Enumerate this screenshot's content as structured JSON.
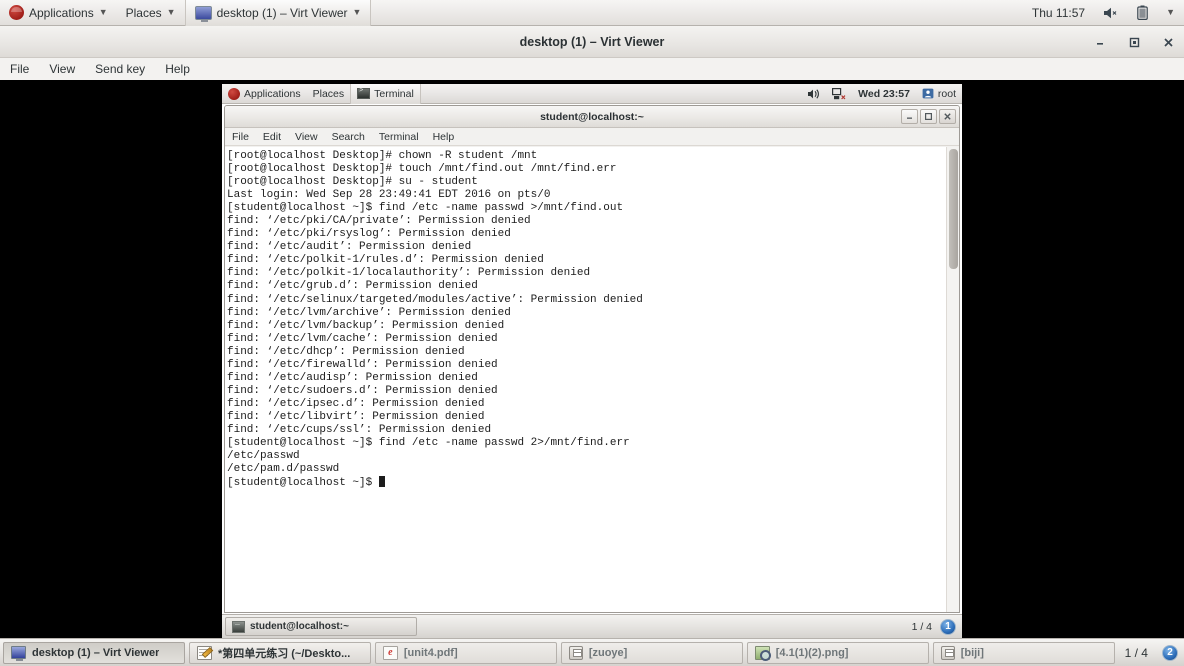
{
  "host_panel": {
    "applications_label": "Applications",
    "places_label": "Places",
    "active_window_label": "desktop (1) – Virt Viewer",
    "clock": "Thu 11:57",
    "icons": [
      "fedora-logo",
      "volume-muted-icon",
      "battery-icon",
      "chevron-down-icon"
    ]
  },
  "virt_viewer": {
    "title": "desktop (1) – Virt Viewer",
    "menu": [
      "File",
      "View",
      "Send key",
      "Help"
    ],
    "window_buttons": {
      "minimize": "–",
      "maximize": "❐",
      "close": "✕"
    }
  },
  "vm": {
    "top_panel": {
      "applications_label": "Applications",
      "places_label": "Places",
      "active_window_label": "Terminal",
      "clock": "Wed 23:57",
      "user": "root",
      "icons": [
        "volume-icon",
        "network-disconnected-icon",
        "user-icon"
      ]
    },
    "terminal": {
      "title": "student@localhost:~",
      "menu": [
        "File",
        "Edit",
        "View",
        "Search",
        "Terminal",
        "Help"
      ],
      "window_buttons": {
        "minimize": "–",
        "maximize": "❐",
        "close": "✕"
      },
      "lines": [
        "[root@localhost Desktop]# chown -R student /mnt",
        "[root@localhost Desktop]# touch /mnt/find.out /mnt/find.err",
        "[root@localhost Desktop]# su - student",
        "Last login: Wed Sep 28 23:49:41 EDT 2016 on pts/0",
        "[student@localhost ~]$ find /etc -name passwd >/mnt/find.out",
        "find: ‘/etc/pki/CA/private’: Permission denied",
        "find: ‘/etc/pki/rsyslog’: Permission denied",
        "find: ‘/etc/audit’: Permission denied",
        "find: ‘/etc/polkit-1/rules.d’: Permission denied",
        "find: ‘/etc/polkit-1/localauthority’: Permission denied",
        "find: ‘/etc/grub.d’: Permission denied",
        "find: ‘/etc/selinux/targeted/modules/active’: Permission denied",
        "find: ‘/etc/lvm/archive’: Permission denied",
        "find: ‘/etc/lvm/backup’: Permission denied",
        "find: ‘/etc/lvm/cache’: Permission denied",
        "find: ‘/etc/dhcp’: Permission denied",
        "find: ‘/etc/firewalld’: Permission denied",
        "find: ‘/etc/audisp’: Permission denied",
        "find: ‘/etc/sudoers.d’: Permission denied",
        "find: ‘/etc/ipsec.d’: Permission denied",
        "find: ‘/etc/libvirt’: Permission denied",
        "find: ‘/etc/cups/ssl’: Permission denied",
        "[student@localhost ~]$ find /etc -name passwd 2>/mnt/find.err",
        "/etc/passwd",
        "/etc/pam.d/passwd",
        "[student@localhost ~]$ "
      ]
    },
    "bottom_panel": {
      "task_label": "student@localhost:~",
      "workspace": "1 / 4",
      "badge": "1"
    }
  },
  "host_taskbar": {
    "items": [
      {
        "label": "desktop (1) – Virt Viewer",
        "icon": "monitor-icon",
        "state": "pressed"
      },
      {
        "label": "*第四单元练习 (~/Deskto...",
        "icon": "notepad-icon",
        "state": "normal"
      },
      {
        "label": "[unit4.pdf]",
        "icon": "pdf-icon",
        "state": "dim"
      },
      {
        "label": "[zuoye]",
        "icon": "archive-icon",
        "state": "dim"
      },
      {
        "label": "[4.1(1)(2).png]",
        "icon": "image-icon",
        "state": "dim"
      },
      {
        "label": "[biji]",
        "icon": "archive-icon",
        "state": "dim"
      }
    ],
    "workspace": "1 / 4",
    "badge": "2"
  },
  "colors": {
    "panel_bg": "#e8e6e3",
    "terminal_bg": "#ffffff",
    "terminal_fg": "#1c1c1c",
    "letterbox": "#000000",
    "badge_blue": "#2b6cb8"
  }
}
